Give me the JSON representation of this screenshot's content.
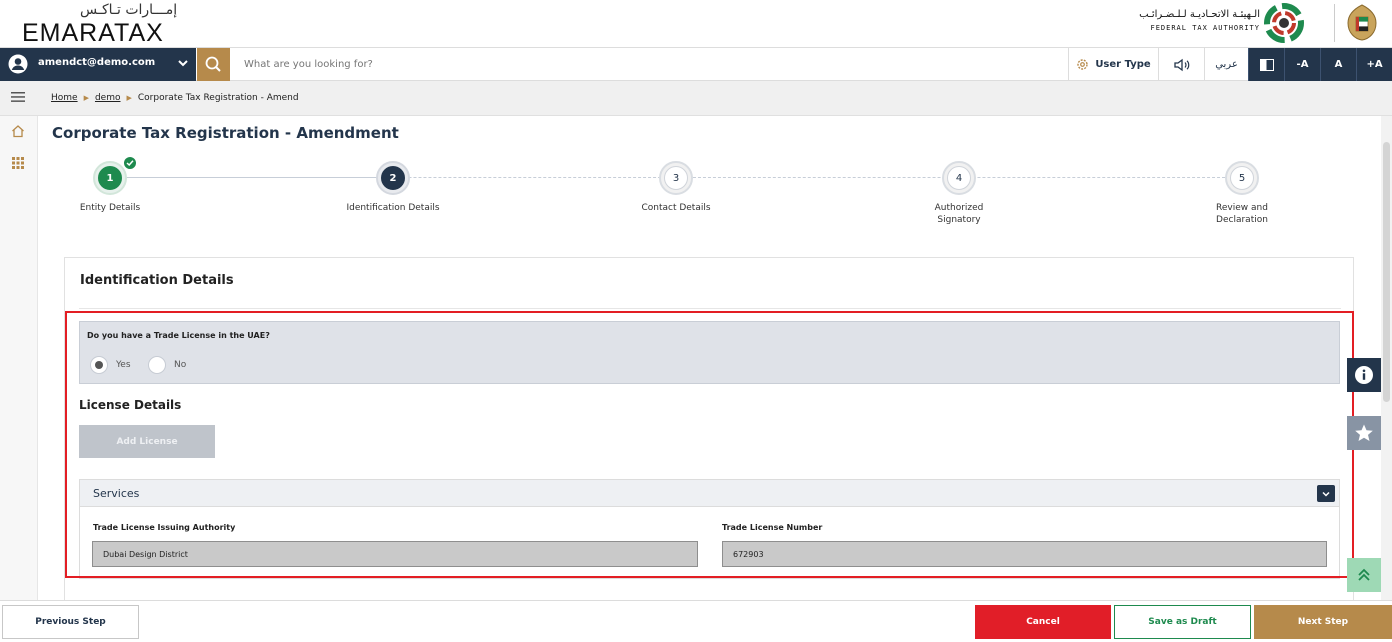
{
  "header": {
    "logo_ar": "إمـــارات تـاكـس",
    "logo_en": "EMARATAX",
    "fta_ar": "الـهيئـة الاتحـاديـة لـلـضـرائـب",
    "fta_en": "FEDERAL TAX AUTHORITY"
  },
  "navbar": {
    "user_email": "amendct@demo.com",
    "search_placeholder": "What are you looking for?",
    "user_type_label": "User Type",
    "arabic_label": "عربي",
    "font_decrease": "-A",
    "font_normal": "A",
    "font_increase": "+A"
  },
  "breadcrumb": {
    "items": [
      "Home",
      "demo",
      "Corporate Tax Registration - Amend"
    ]
  },
  "page": {
    "title": "Corporate Tax Registration - Amendment"
  },
  "stepper": {
    "steps": [
      {
        "number": "1",
        "label": "Entity Details",
        "status": "completed"
      },
      {
        "number": "2",
        "label": "Identification Details",
        "status": "active"
      },
      {
        "number": "3",
        "label": "Contact Details",
        "status": "pending"
      },
      {
        "number": "4",
        "label": "Authorized Signatory",
        "label_line1": "Authorized",
        "label_line2": "Signatory",
        "status": "pending"
      },
      {
        "number": "5",
        "label": "Review and Declaration",
        "label_line1": "Review and",
        "label_line2": "Declaration",
        "status": "pending"
      }
    ]
  },
  "form": {
    "section_title": "Identification Details",
    "trade_license_question": "Do you have a Trade License in the UAE?",
    "radio_yes": "Yes",
    "radio_no": "No",
    "selected_option": "Yes",
    "license_title": "License Details",
    "add_license_label": "Add License",
    "services": {
      "title": "Services",
      "issuing_authority_label": "Trade License Issuing Authority",
      "issuing_authority_value": "Dubai Design District",
      "license_number_label": "Trade License Number",
      "license_number_value": "672903"
    }
  },
  "footer": {
    "previous_label": "Previous Step",
    "cancel_label": "Cancel",
    "draft_label": "Save as Draft",
    "next_label": "Next Step"
  },
  "colors": {
    "navy": "#23354b",
    "gold": "#b68a4b",
    "green": "#1e8a4e",
    "red": "#e11e28",
    "highlight_border": "#e31e24"
  },
  "icons": [
    "user-icon",
    "chevron-down-icon",
    "search-icon",
    "gear-icon",
    "speaker-icon",
    "contrast-icon",
    "menu-icon",
    "home-icon",
    "grid-icon",
    "check-icon",
    "info-icon",
    "star-icon",
    "double-chevron-up-icon"
  ]
}
